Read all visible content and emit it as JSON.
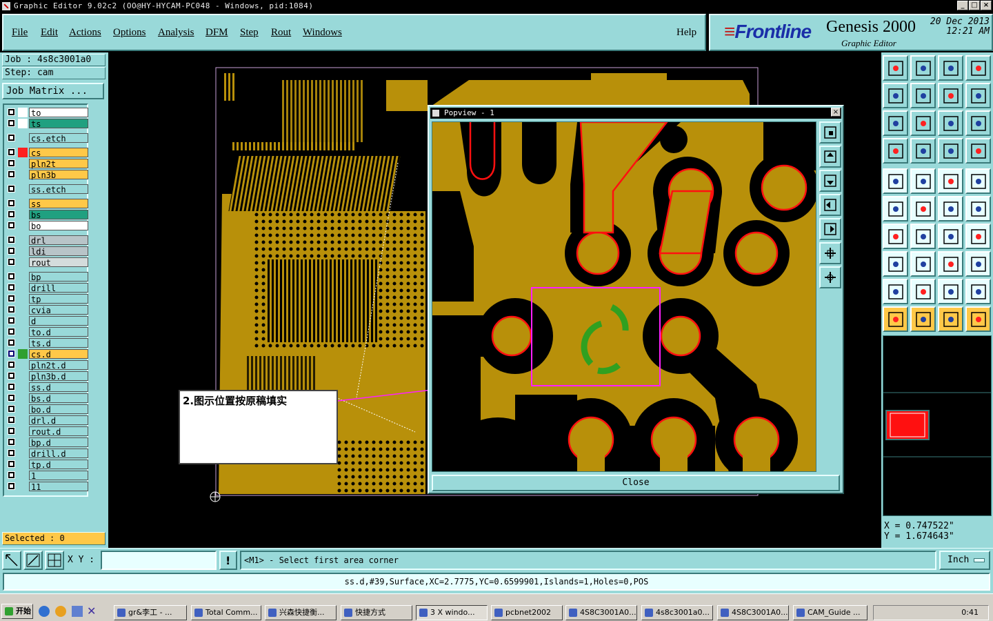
{
  "window": {
    "title": "Graphic Editor 9.02c2 (OO@HY-HYCAM-PC048 - Windows, pid:1084)"
  },
  "menu": [
    "File",
    "Edit",
    "Actions",
    "Options",
    "Analysis",
    "DFM",
    "Step",
    "Rout",
    "Windows"
  ],
  "help": "Help",
  "brand": {
    "logo": "Frontline",
    "product": "Genesis 2000",
    "subtitle": "Graphic Editor",
    "date": "20 Dec 2013",
    "time": "12:21 AM"
  },
  "job": {
    "job": "Job : 4s8c3001a0",
    "step": "Step: cam",
    "matrix": "Job Matrix ..."
  },
  "layers": [
    {
      "name": "to",
      "color": "#ffffff",
      "swatch": "#ffffff"
    },
    {
      "name": "ts",
      "color": "#20a080",
      "swatch": "#ffffff"
    },
    {
      "name": "cs.etch",
      "color": "#99d9d9",
      "swatch": "#99d9d9",
      "gap": true
    },
    {
      "name": "cs",
      "color": "#ffc848",
      "swatch": "#ff2020",
      "gap": true
    },
    {
      "name": "pln2t",
      "color": "#ffc848",
      "swatch": "#99d9d9"
    },
    {
      "name": "pln3b",
      "color": "#ffc848",
      "swatch": "#99d9d9"
    },
    {
      "name": "ss.etch",
      "color": "#99d9d9",
      "swatch": "#99d9d9",
      "gap": true
    },
    {
      "name": "ss",
      "color": "#ffc848",
      "swatch": "#99d9d9",
      "gap": true
    },
    {
      "name": "bs",
      "color": "#20a080",
      "swatch": "#99d9d9"
    },
    {
      "name": "bo",
      "color": "#ffffff",
      "swatch": "#99d9d9",
      "mark": "◢"
    },
    {
      "name": "drl",
      "color": "#b8c4c8",
      "swatch": "#99d9d9",
      "gap": true
    },
    {
      "name": "ldi",
      "color": "#b8c4c8",
      "swatch": "#99d9d9"
    },
    {
      "name": "rout",
      "color": "#d4dcdc",
      "swatch": "#99d9d9"
    },
    {
      "name": "bp",
      "color": "#99d9d9",
      "swatch": "#99d9d9",
      "gap": true
    },
    {
      "name": "drill",
      "color": "#99d9d9",
      "swatch": "#99d9d9"
    },
    {
      "name": "tp",
      "color": "#99d9d9",
      "swatch": "#99d9d9"
    },
    {
      "name": "cvia",
      "color": "#99d9d9",
      "swatch": "#99d9d9"
    },
    {
      "name": "d",
      "color": "#99d9d9",
      "swatch": "#99d9d9"
    },
    {
      "name": "to.d",
      "color": "#99d9d9",
      "swatch": "#99d9d9"
    },
    {
      "name": "ts.d",
      "color": "#99d9d9",
      "swatch": "#99d9d9"
    },
    {
      "name": "cs.d",
      "color": "#ffc848",
      "swatch": "#30a030",
      "sel": true,
      "mark": "▣"
    },
    {
      "name": "pln2t.d",
      "color": "#99d9d9",
      "swatch": "#99d9d9"
    },
    {
      "name": "pln3b.d",
      "color": "#99d9d9",
      "swatch": "#99d9d9"
    },
    {
      "name": "ss.d",
      "color": "#99d9d9",
      "swatch": "#99d9d9"
    },
    {
      "name": "bs.d",
      "color": "#99d9d9",
      "swatch": "#99d9d9"
    },
    {
      "name": "bo.d",
      "color": "#99d9d9",
      "swatch": "#99d9d9",
      "mark": "◢"
    },
    {
      "name": "drl.d",
      "color": "#99d9d9",
      "swatch": "#99d9d9"
    },
    {
      "name": "rout.d",
      "color": "#99d9d9",
      "swatch": "#99d9d9"
    },
    {
      "name": "bp.d",
      "color": "#99d9d9",
      "swatch": "#99d9d9"
    },
    {
      "name": "drill.d",
      "color": "#99d9d9",
      "swatch": "#99d9d9"
    },
    {
      "name": "tp.d",
      "color": "#99d9d9",
      "swatch": "#99d9d9"
    },
    {
      "name": "1",
      "color": "#99d9d9",
      "swatch": "#99d9d9"
    },
    {
      "name": "11",
      "color": "#99d9d9",
      "swatch": "#99d9d9"
    }
  ],
  "selected": "Selected : 0",
  "popview": {
    "title": "Popview - 1",
    "close": "Close"
  },
  "annotation": "2.图示位置按原稿填实",
  "coords": {
    "x": "X = 0.747522\"",
    "y": "Y = 1.674643\""
  },
  "cmd": {
    "xy_label": "X Y :",
    "xy_value": "",
    "prompt": "<M1> - Select first area corner",
    "unit": "Inch"
  },
  "status": "ss.d,#39,Surface,XC=2.7775,YC=0.6599901,Islands=1,Holes=0,POS",
  "taskbar": {
    "start": "开始",
    "clock": "0:41",
    "items": [
      "gr&李工 - ...",
      "Total Comm...",
      "兴森快捷衡...",
      "快捷方式",
      "3 X windo...",
      "pcbnet2002",
      "4S8C3001A0...",
      "4s8c3001a0...",
      "4S8C3001A0...",
      "CAM_Guide ..."
    ]
  },
  "colors": {
    "bg": "#99d9d9",
    "copper": "#b8900a",
    "pad_outline": "#ff1010",
    "highlight": "#ff20ff",
    "green": "#30a020"
  }
}
